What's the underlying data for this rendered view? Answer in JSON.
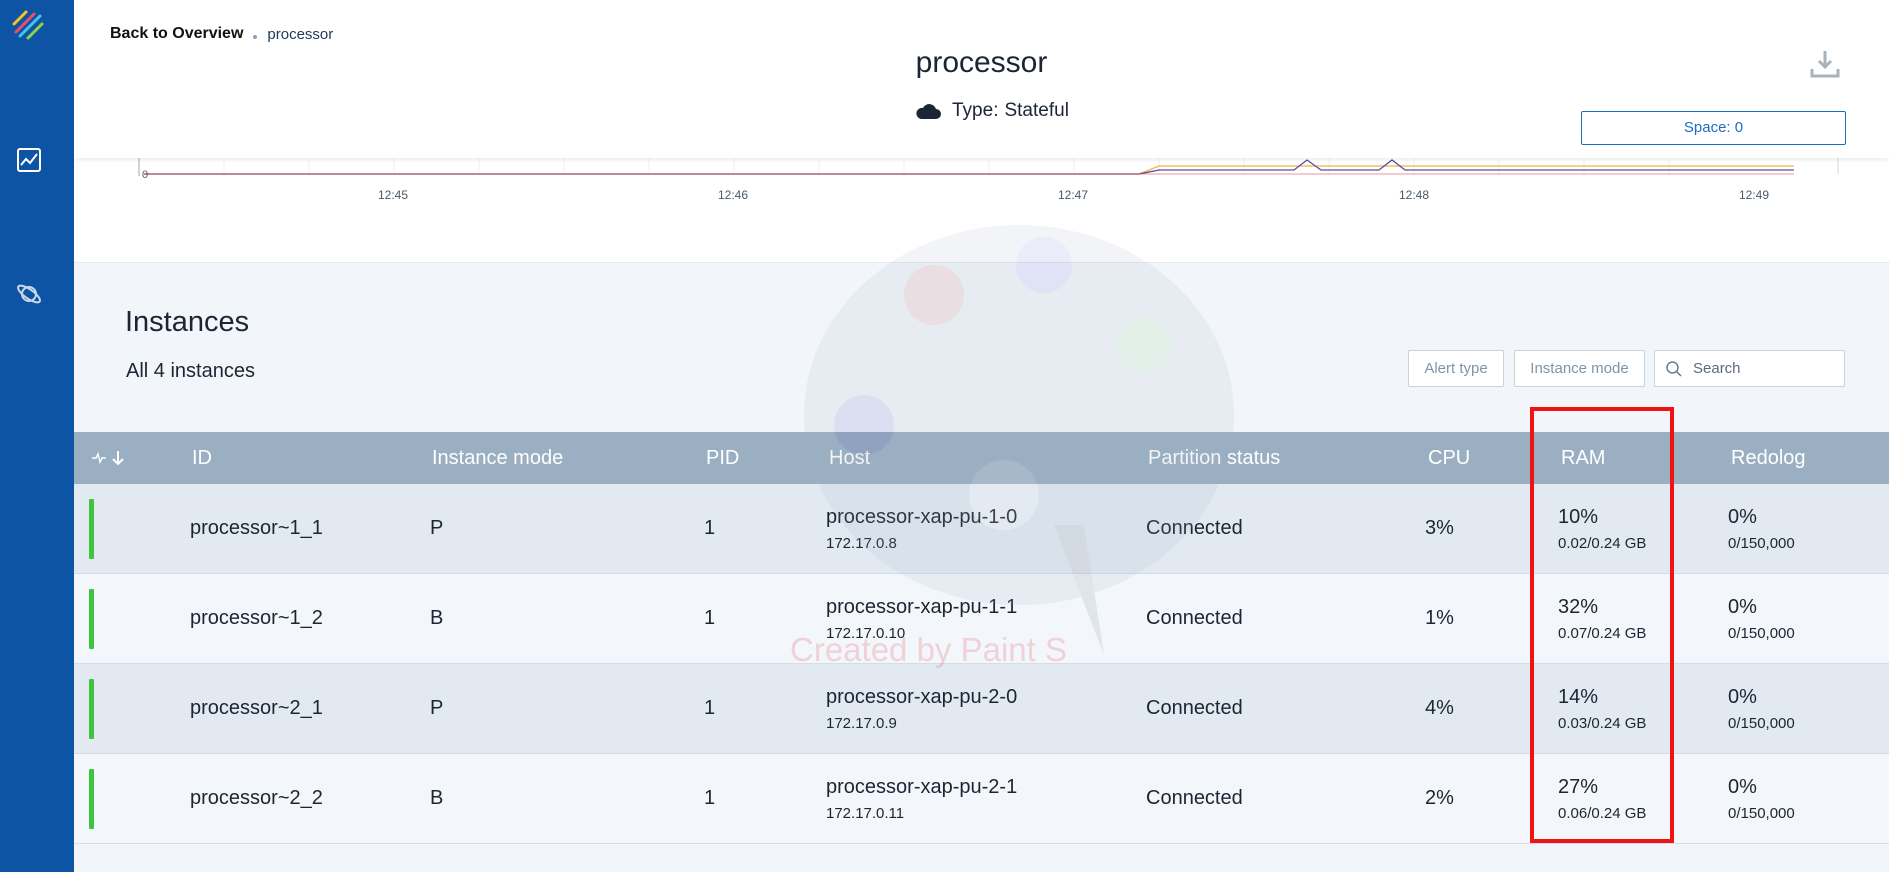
{
  "sidebar": {
    "logo": "brand-logo",
    "icons": [
      "chart-icon",
      "planet-icon"
    ]
  },
  "header": {
    "back_label": "Back to Overview",
    "breadcrumb_current": "processor",
    "title": "processor",
    "type_label": "Type:",
    "type_value": "Stateful",
    "space_button": "Space: 0"
  },
  "chart": {
    "y_tick": "0",
    "x_ticks": [
      "12:45",
      "12:46",
      "12:47",
      "12:48",
      "12:49"
    ]
  },
  "instances": {
    "title": "Instances",
    "count_label": "All 4 instances",
    "filters": {
      "alert_type": "Alert type",
      "instance_mode": "Instance mode",
      "search_placeholder": "Search"
    },
    "columns": [
      "ID",
      "Instance mode",
      "PID",
      "Host",
      "Partition status",
      "CPU",
      "RAM",
      "Redolog"
    ],
    "rows": [
      {
        "id": "processor~1_1",
        "mode": "P",
        "pid": "1",
        "host": "processor-xap-pu-1-0",
        "ip": "172.17.0.8",
        "partition": "Connected",
        "cpu": "3%",
        "ram": "10%",
        "ram_detail": "0.02/0.24 GB",
        "redolog": "0%",
        "redolog_detail": "0/150,000"
      },
      {
        "id": "processor~1_2",
        "mode": "B",
        "pid": "1",
        "host": "processor-xap-pu-1-1",
        "ip": "172.17.0.10",
        "partition": "Connected",
        "cpu": "1%",
        "ram": "32%",
        "ram_detail": "0.07/0.24 GB",
        "redolog": "0%",
        "redolog_detail": "0/150,000"
      },
      {
        "id": "processor~2_1",
        "mode": "P",
        "pid": "1",
        "host": "processor-xap-pu-2-0",
        "ip": "172.17.0.9",
        "partition": "Connected",
        "cpu": "4%",
        "ram": "14%",
        "ram_detail": "0.03/0.24 GB",
        "redolog": "0%",
        "redolog_detail": "0/150,000"
      },
      {
        "id": "processor~2_2",
        "mode": "B",
        "pid": "1",
        "host": "processor-xap-pu-2-1",
        "ip": "172.17.0.11",
        "partition": "Connected",
        "cpu": "2%",
        "ram": "27%",
        "ram_detail": "0.06/0.24 GB",
        "redolog": "0%",
        "redolog_detail": "0/150,000"
      }
    ]
  },
  "watermark": "Created by Paint S",
  "colors": {
    "sidebar": "#0d55a4",
    "header_row": "#9bafc2",
    "status_ok": "#3ec43e",
    "highlight": "#ee1414",
    "accent": "#1f6cc4"
  }
}
